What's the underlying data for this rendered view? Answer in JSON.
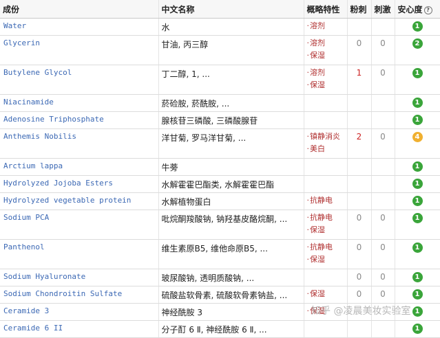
{
  "header": {
    "ingredient": "成份",
    "chinese_name": "中文名称",
    "properties": "概略特性",
    "acne": "粉刺",
    "irritation": "刺激",
    "safety": "安心度",
    "help": "?"
  },
  "rows": [
    {
      "ingredient": "Water",
      "chinese_name": "水",
      "properties": [
        "溶剂"
      ],
      "acne": "",
      "irritation": "",
      "safety": "1",
      "safety_color": "#3aa53a"
    },
    {
      "ingredient": "Glycerin",
      "chinese_name": "甘油, 丙三醇",
      "properties": [
        "溶剂",
        "保湿"
      ],
      "acne": "0",
      "irritation": "0",
      "safety": "2",
      "safety_color": "#3aa53a"
    },
    {
      "ingredient": "Butylene Glycol",
      "chinese_name": "丁二醇, 1, ...",
      "properties": [
        "溶剂",
        "保湿"
      ],
      "acne": "1",
      "irritation": "0",
      "safety": "1",
      "safety_color": "#3aa53a"
    },
    {
      "ingredient": "Niacinamide",
      "chinese_name": "菸硷胺, 菸酰胺, ...",
      "properties": [],
      "acne": "",
      "irritation": "",
      "safety": "1",
      "safety_color": "#3aa53a"
    },
    {
      "ingredient": "Adenosine Triphosphate",
      "chinese_name": "腺核苷三磷酸, 三磷酸腺苷",
      "properties": [],
      "acne": "",
      "irritation": "",
      "safety": "1",
      "safety_color": "#3aa53a"
    },
    {
      "ingredient": "Anthemis Nobilis",
      "chinese_name": "洋甘菊, 罗马洋甘菊, ...",
      "properties": [
        "镇静消炎",
        "美白"
      ],
      "acne": "2",
      "irritation": "0",
      "safety": "4",
      "safety_color": "#f0b030"
    },
    {
      "ingredient": "Arctium lappa",
      "chinese_name": "牛蒡",
      "properties": [],
      "acne": "",
      "irritation": "",
      "safety": "1",
      "safety_color": "#3aa53a"
    },
    {
      "ingredient": "Hydrolyzed Jojoba Esters",
      "chinese_name": "水解霍霍巴酯类, 水解霍霍巴酯",
      "properties": [],
      "acne": "",
      "irritation": "",
      "safety": "1",
      "safety_color": "#3aa53a"
    },
    {
      "ingredient": "Hydrolyzed vegetable protein",
      "chinese_name": "水解植物蛋白",
      "properties": [
        "抗静电"
      ],
      "acne": "",
      "irritation": "",
      "safety": "1",
      "safety_color": "#3aa53a"
    },
    {
      "ingredient": "Sodium PCA",
      "chinese_name": "吡烷酮羧酸钠, 钠羟基皮酪烷酮, ...",
      "properties": [
        "抗静电",
        "保湿"
      ],
      "acne": "0",
      "irritation": "0",
      "safety": "1",
      "safety_color": "#3aa53a"
    },
    {
      "ingredient": "Panthenol",
      "chinese_name": "维生素原B5, 维他命原B5, ...",
      "properties": [
        "抗静电",
        "保湿"
      ],
      "acne": "0",
      "irritation": "0",
      "safety": "1",
      "safety_color": "#3aa53a"
    },
    {
      "ingredient": "Sodium Hyaluronate",
      "chinese_name": "玻尿酸钠, 透明质酸钠, ...",
      "properties": [],
      "acne": "0",
      "irritation": "0",
      "safety": "1",
      "safety_color": "#3aa53a"
    },
    {
      "ingredient": "Sodium Chondroitin Sulfate",
      "chinese_name": "硫酸盐软骨素, 硫酸软骨素钠盐, ...",
      "properties": [
        "保湿"
      ],
      "acne": "0",
      "irritation": "0",
      "safety": "1",
      "safety_color": "#3aa53a"
    },
    {
      "ingredient": "Ceramide 3",
      "chinese_name": "神经酰胺 3",
      "properties": [
        "保湿"
      ],
      "acne": "",
      "irritation": "",
      "safety": "1",
      "safety_color": "#3aa53a"
    },
    {
      "ingredient": "Ceramide 6 II",
      "chinese_name": "分子酊 6 Ⅱ, 神经酰胺 6 Ⅱ, ...",
      "properties": [],
      "acne": "",
      "irritation": "",
      "safety": "1",
      "safety_color": "#3aa53a"
    }
  ],
  "watermark": "知乎 @凌晨美妆实验室"
}
